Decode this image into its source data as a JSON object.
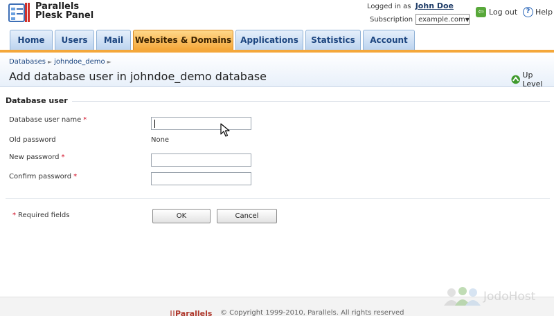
{
  "brand": {
    "line1": "Parallels",
    "line2": "Plesk Panel"
  },
  "session": {
    "logged_in_label": "Logged in as",
    "user_name": "John Doe",
    "subscription_label": "Subscription",
    "subscription_value": "example.com",
    "logout_label": "Log out",
    "help_label": "Help"
  },
  "tabs": [
    {
      "label": "Home"
    },
    {
      "label": "Users"
    },
    {
      "label": "Mail"
    },
    {
      "label": "Websites & Domains",
      "active": true
    },
    {
      "label": "Applications"
    },
    {
      "label": "Statistics"
    },
    {
      "label": "Account"
    }
  ],
  "breadcrumb": [
    "Databases",
    "johndoe_demo"
  ],
  "page_title": "Add database user in johndoe_demo database",
  "up_level_label": "Up Level",
  "form": {
    "section_title": "Database user",
    "fields": {
      "username_label": "Database user name",
      "username_value": "",
      "old_password_label": "Old password",
      "old_password_value": "None",
      "new_password_label": "New password",
      "new_password_value": "",
      "confirm_password_label": "Confirm password",
      "confirm_password_value": ""
    },
    "required_marker": "*",
    "required_note": "Required fields",
    "ok_label": "OK",
    "cancel_label": "Cancel"
  },
  "footer": {
    "logo_text": "||Parallels",
    "copyright": "© Copyright 1999-2010, Parallels. All rights reserved"
  },
  "watermark": "JodoHost",
  "colors": {
    "active_tab": "#f4a73a",
    "tab": "#bcd4ef",
    "link": "#1d4680",
    "required": "#d0021b"
  }
}
